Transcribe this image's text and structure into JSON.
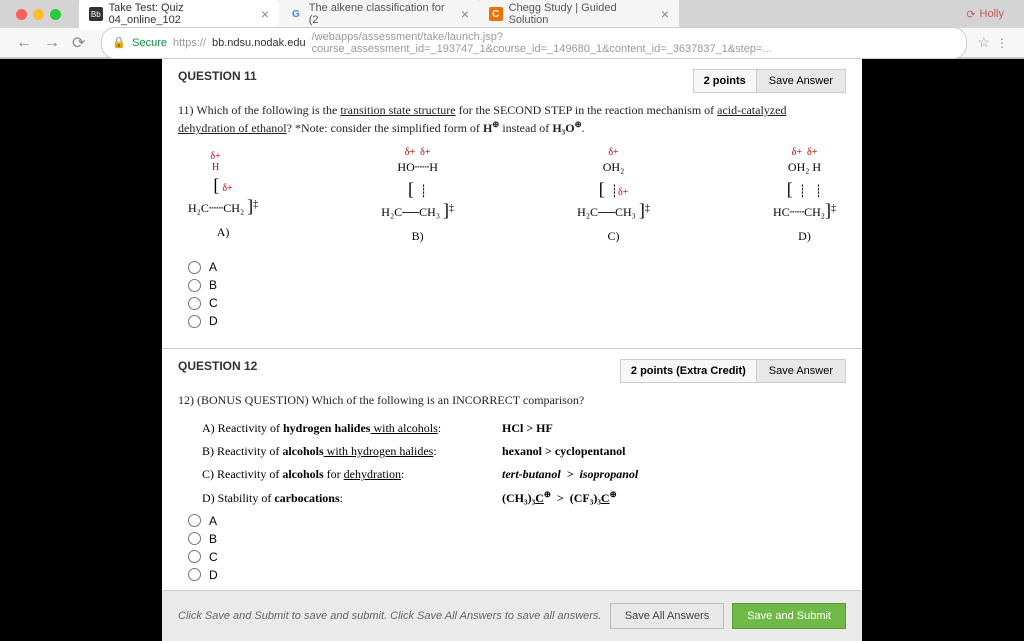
{
  "browser": {
    "user": "Holly",
    "tabs": [
      {
        "title": "Take Test: Quiz 04_online_102",
        "favicon": "Bb"
      },
      {
        "title": "The alkene classification for (2",
        "favicon": "G"
      },
      {
        "title": "Chegg Study | Guided Solution",
        "favicon": "C"
      }
    ],
    "url_secure": "Secure",
    "url_prefix": "https://",
    "url_host": "bb.ndsu.nodak.edu",
    "url_path": "/webapps/assessment/take/launch.jsp?course_assessment_id=_193747_1&course_id=_149680_1&content_id=_3637837_1&step=..."
  },
  "q11": {
    "header": "QUESTION 11",
    "points": "2 points",
    "save": "Save Answer",
    "stem_num": "11)",
    "stem_pre": "  Which of the following is the ",
    "stem_und1": "transition state structure",
    "stem_mid1": " for the SECOND STEP in the reaction mechanism of ",
    "stem_und2": "acid-catalyzed dehydration of ethanol",
    "stem_post": "?  *Note: consider the simplified form of ",
    "stem_h": "H",
    "stem_sup": "⊕",
    "stem_inst": " instead of ",
    "stem_h3o": "H₃O",
    "stem_end": ".",
    "struct_a": "A)",
    "struct_b": "B)",
    "struct_c": "C)",
    "struct_d": "D)",
    "options": [
      "A",
      "B",
      "C",
      "D"
    ]
  },
  "q12": {
    "header": "QUESTION 12",
    "points": "2 points (Extra Credit)",
    "save": "Save Answer",
    "stem": "12)  (BONUS QUESTION) Which of the following is an INCORRECT comparison?",
    "rows": [
      {
        "l_pre": "A)  Reactivity of ",
        "l_b": "hydrogen halides",
        "l_u": " with alcohols",
        "l_post": ":",
        "r": "HCl  >  HF"
      },
      {
        "l_pre": "B)  Reactivity of ",
        "l_b": "alcohols",
        "l_u": " with hydrogen halides",
        "l_post": ":",
        "r": "hexanol  >  cyclopentanol"
      },
      {
        "l_pre": "C)  Reactivity of ",
        "l_b": "alcohols",
        "l_u": "",
        "l_post": " for ",
        "l_u2": "dehydration",
        "l_post2": ":",
        "r": "tert-butanol  >  isopropanol",
        "ital": true
      },
      {
        "l_pre": "D)  Stability of ",
        "l_b": "carbocations",
        "l_u": "",
        "l_post": ":",
        "r": "(CH₃)₃C⊕  >  (CF₃)₃C⊕"
      }
    ],
    "options": [
      "A",
      "B",
      "C",
      "D"
    ]
  },
  "footer": {
    "hint": "Click Save and Submit to save and submit. Click Save All Answers to save all answers.",
    "save_all": "Save All Answers",
    "submit": "Save and Submit"
  }
}
